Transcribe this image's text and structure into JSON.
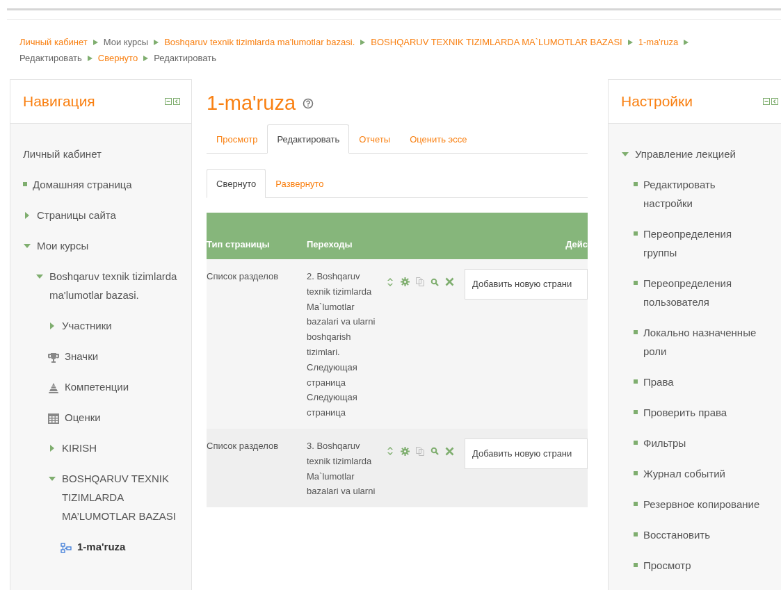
{
  "breadcrumb": [
    {
      "label": "Личный кабинет",
      "link": true
    },
    {
      "label": "Мои курсы",
      "link": false
    },
    {
      "label": "Boshqaruv texnik tizimlarda ma'lumotlar bazasi.",
      "link": true
    },
    {
      "label": "BOSHQARUV TEXNIK TIZIMLARDA MA`LUMOTLAR BAZASI",
      "link": true
    },
    {
      "label": "1-ma'ruza",
      "link": true
    },
    {
      "label": "Редактировать",
      "link": false
    },
    {
      "label": "Свернуто",
      "link": true
    },
    {
      "label": "Редактировать",
      "link": false
    }
  ],
  "navigation": {
    "title": "Навигация",
    "items": [
      {
        "label": "Личный кабинет",
        "kind": "link"
      },
      {
        "label": "Домашняя страница",
        "kind": "page"
      },
      {
        "label": "Страницы сайта",
        "kind": "branch",
        "expanded": false
      },
      {
        "label": "Мои курсы",
        "kind": "branch",
        "expanded": true,
        "children": [
          {
            "label": "Boshqaruv texnik tizimlarda ma'lumotlar bazasi.",
            "kind": "branch",
            "expanded": true,
            "children": [
              {
                "label": "Участники",
                "kind": "branch",
                "expanded": false
              },
              {
                "label": "Значки",
                "kind": "badges"
              },
              {
                "label": "Компетенции",
                "kind": "competencies"
              },
              {
                "label": "Оценки",
                "kind": "grades"
              },
              {
                "label": "KIRISH",
                "kind": "branch",
                "expanded": false
              },
              {
                "label": "BOSHQARUV TEXNIK TIZIMLARDA MA’LUMOTLAR BAZASI",
                "kind": "branch",
                "expanded": true,
                "children": [
                  {
                    "label": "1-ma'ruza",
                    "kind": "lesson"
                  }
                ]
              }
            ]
          }
        ]
      }
    ]
  },
  "main": {
    "title": "1-ma'ruza",
    "tabs": [
      {
        "label": "Просмотр",
        "selected": false
      },
      {
        "label": "Редактировать",
        "selected": true
      },
      {
        "label": "Отчеты",
        "selected": false
      },
      {
        "label": "Оценить эссе",
        "selected": false
      }
    ],
    "subtabs": [
      {
        "label": "Свернуто",
        "selected": true
      },
      {
        "label": "Развернуто",
        "selected": false
      }
    ],
    "table": {
      "columns": [
        "Тип страницы",
        "Переходы",
        "Дейс"
      ],
      "rows": [
        {
          "page_type": "Список разделов",
          "transitions": "2. Boshqaruv texnik tizimlarda Ma`lumotlar bazalari va ularni boshqarish tizimlari. Следующая страница Следующая страница",
          "add_page": "Добавить новую страни"
        },
        {
          "page_type": "Список разделов",
          "transitions": "3. Boshqaruv texnik tizimlarda Ma`lumotlar bazalari va ularni",
          "add_page": "Добавить новую страни"
        }
      ]
    }
  },
  "settings": {
    "title": "Настройки",
    "items": [
      {
        "label": "Управление лекцией",
        "kind": "branch",
        "expanded": true,
        "children": [
          {
            "label": "Редактировать настройки",
            "kind": "page"
          },
          {
            "label": "Переопределения группы",
            "kind": "page"
          },
          {
            "label": "Переопределения пользователя",
            "kind": "page"
          },
          {
            "label": "Локально назначенные роли",
            "kind": "page"
          },
          {
            "label": "Права",
            "kind": "page"
          },
          {
            "label": "Проверить права",
            "kind": "page"
          },
          {
            "label": "Фильтры",
            "kind": "page"
          },
          {
            "label": "Журнал событий",
            "kind": "page"
          },
          {
            "label": "Резервное копирование",
            "kind": "page"
          },
          {
            "label": "Восстановить",
            "kind": "page"
          },
          {
            "label": "Просмотр",
            "kind": "page"
          }
        ]
      }
    ]
  }
}
